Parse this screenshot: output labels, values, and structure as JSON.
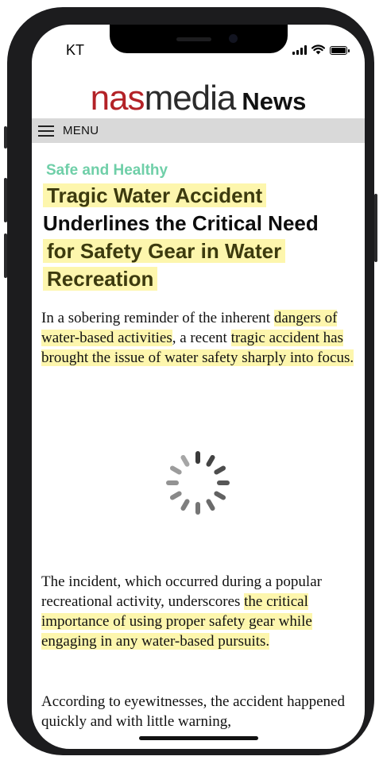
{
  "status_bar": {
    "carrier": "KT",
    "icons": [
      "cellular-signal-icon",
      "wifi-icon",
      "battery-icon"
    ]
  },
  "masthead": {
    "brand_part1": "nas",
    "brand_part2": "media",
    "brand_suffix": "News",
    "colors": {
      "brand_red": "#b32227",
      "brand_dark": "#2b2b2b"
    }
  },
  "menu": {
    "label": "MENU",
    "icon": "hamburger-menu-icon"
  },
  "article": {
    "category": "Safe and Healthy",
    "headline_lines": [
      {
        "text": "Tragic Water Accident",
        "highlighted": true
      },
      {
        "text": "Underlines the Critical Need",
        "highlighted": false
      },
      {
        "text": "for Safety Gear in Water",
        "highlighted": true
      },
      {
        "text": "Recreation",
        "highlighted": true
      }
    ],
    "paragraphs": [
      {
        "text_a": "In a sobering reminder of the inherent ",
        "highlight_1": "dangers of water-based activities",
        "text_b": ", a recent ",
        "highlight_2": "tragic accident has brought the issue of water safety sharply into focus."
      },
      {
        "text_a": "The incident, which occurred during a popular recreational activity, underscores ",
        "highlight_1": "the critical importance of using proper safety gear while engaging in any water-based pursuits."
      },
      {
        "text_a": "According to eyewitnesses, the accident happened quickly and with little warning,"
      }
    ],
    "loading_indicator": "loading-spinner-icon",
    "colors": {
      "category_green": "#6fcfa8",
      "highlight_yellow": "#fdf6ad"
    }
  }
}
